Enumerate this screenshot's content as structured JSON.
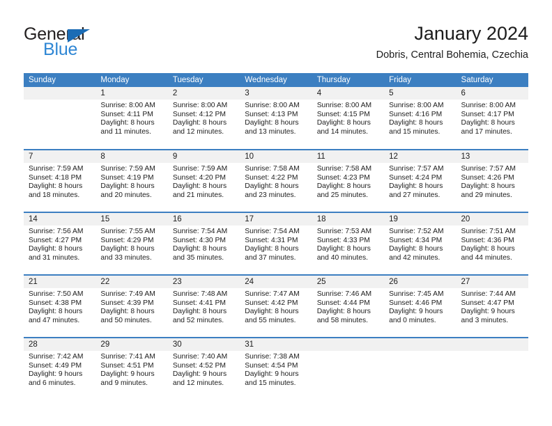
{
  "brand": {
    "name_part1": "General",
    "name_part2": "Blue",
    "triangle_color": "#1b6cb5",
    "blue_color": "#2e86d4"
  },
  "header": {
    "title": "January 2024",
    "subtitle": "Dobris, Central Bohemia, Czechia"
  },
  "theme": {
    "header_blue": "#3c7fc1",
    "band_gray": "#f1f1f1",
    "text": "#1c1c1c"
  },
  "weekdays": [
    "Sunday",
    "Monday",
    "Tuesday",
    "Wednesday",
    "Thursday",
    "Friday",
    "Saturday"
  ],
  "weeks": [
    [
      {
        "day": "",
        "sunrise": "",
        "sunset": "",
        "daylight_line1": "",
        "daylight_line2": ""
      },
      {
        "day": "1",
        "sunrise": "Sunrise: 8:00 AM",
        "sunset": "Sunset: 4:11 PM",
        "daylight_line1": "Daylight: 8 hours",
        "daylight_line2": "and 11 minutes."
      },
      {
        "day": "2",
        "sunrise": "Sunrise: 8:00 AM",
        "sunset": "Sunset: 4:12 PM",
        "daylight_line1": "Daylight: 8 hours",
        "daylight_line2": "and 12 minutes."
      },
      {
        "day": "3",
        "sunrise": "Sunrise: 8:00 AM",
        "sunset": "Sunset: 4:13 PM",
        "daylight_line1": "Daylight: 8 hours",
        "daylight_line2": "and 13 minutes."
      },
      {
        "day": "4",
        "sunrise": "Sunrise: 8:00 AM",
        "sunset": "Sunset: 4:15 PM",
        "daylight_line1": "Daylight: 8 hours",
        "daylight_line2": "and 14 minutes."
      },
      {
        "day": "5",
        "sunrise": "Sunrise: 8:00 AM",
        "sunset": "Sunset: 4:16 PM",
        "daylight_line1": "Daylight: 8 hours",
        "daylight_line2": "and 15 minutes."
      },
      {
        "day": "6",
        "sunrise": "Sunrise: 8:00 AM",
        "sunset": "Sunset: 4:17 PM",
        "daylight_line1": "Daylight: 8 hours",
        "daylight_line2": "and 17 minutes."
      }
    ],
    [
      {
        "day": "7",
        "sunrise": "Sunrise: 7:59 AM",
        "sunset": "Sunset: 4:18 PM",
        "daylight_line1": "Daylight: 8 hours",
        "daylight_line2": "and 18 minutes."
      },
      {
        "day": "8",
        "sunrise": "Sunrise: 7:59 AM",
        "sunset": "Sunset: 4:19 PM",
        "daylight_line1": "Daylight: 8 hours",
        "daylight_line2": "and 20 minutes."
      },
      {
        "day": "9",
        "sunrise": "Sunrise: 7:59 AM",
        "sunset": "Sunset: 4:20 PM",
        "daylight_line1": "Daylight: 8 hours",
        "daylight_line2": "and 21 minutes."
      },
      {
        "day": "10",
        "sunrise": "Sunrise: 7:58 AM",
        "sunset": "Sunset: 4:22 PM",
        "daylight_line1": "Daylight: 8 hours",
        "daylight_line2": "and 23 minutes."
      },
      {
        "day": "11",
        "sunrise": "Sunrise: 7:58 AM",
        "sunset": "Sunset: 4:23 PM",
        "daylight_line1": "Daylight: 8 hours",
        "daylight_line2": "and 25 minutes."
      },
      {
        "day": "12",
        "sunrise": "Sunrise: 7:57 AM",
        "sunset": "Sunset: 4:24 PM",
        "daylight_line1": "Daylight: 8 hours",
        "daylight_line2": "and 27 minutes."
      },
      {
        "day": "13",
        "sunrise": "Sunrise: 7:57 AM",
        "sunset": "Sunset: 4:26 PM",
        "daylight_line1": "Daylight: 8 hours",
        "daylight_line2": "and 29 minutes."
      }
    ],
    [
      {
        "day": "14",
        "sunrise": "Sunrise: 7:56 AM",
        "sunset": "Sunset: 4:27 PM",
        "daylight_line1": "Daylight: 8 hours",
        "daylight_line2": "and 31 minutes."
      },
      {
        "day": "15",
        "sunrise": "Sunrise: 7:55 AM",
        "sunset": "Sunset: 4:29 PM",
        "daylight_line1": "Daylight: 8 hours",
        "daylight_line2": "and 33 minutes."
      },
      {
        "day": "16",
        "sunrise": "Sunrise: 7:54 AM",
        "sunset": "Sunset: 4:30 PM",
        "daylight_line1": "Daylight: 8 hours",
        "daylight_line2": "and 35 minutes."
      },
      {
        "day": "17",
        "sunrise": "Sunrise: 7:54 AM",
        "sunset": "Sunset: 4:31 PM",
        "daylight_line1": "Daylight: 8 hours",
        "daylight_line2": "and 37 minutes."
      },
      {
        "day": "18",
        "sunrise": "Sunrise: 7:53 AM",
        "sunset": "Sunset: 4:33 PM",
        "daylight_line1": "Daylight: 8 hours",
        "daylight_line2": "and 40 minutes."
      },
      {
        "day": "19",
        "sunrise": "Sunrise: 7:52 AM",
        "sunset": "Sunset: 4:34 PM",
        "daylight_line1": "Daylight: 8 hours",
        "daylight_line2": "and 42 minutes."
      },
      {
        "day": "20",
        "sunrise": "Sunrise: 7:51 AM",
        "sunset": "Sunset: 4:36 PM",
        "daylight_line1": "Daylight: 8 hours",
        "daylight_line2": "and 44 minutes."
      }
    ],
    [
      {
        "day": "21",
        "sunrise": "Sunrise: 7:50 AM",
        "sunset": "Sunset: 4:38 PM",
        "daylight_line1": "Daylight: 8 hours",
        "daylight_line2": "and 47 minutes."
      },
      {
        "day": "22",
        "sunrise": "Sunrise: 7:49 AM",
        "sunset": "Sunset: 4:39 PM",
        "daylight_line1": "Daylight: 8 hours",
        "daylight_line2": "and 50 minutes."
      },
      {
        "day": "23",
        "sunrise": "Sunrise: 7:48 AM",
        "sunset": "Sunset: 4:41 PM",
        "daylight_line1": "Daylight: 8 hours",
        "daylight_line2": "and 52 minutes."
      },
      {
        "day": "24",
        "sunrise": "Sunrise: 7:47 AM",
        "sunset": "Sunset: 4:42 PM",
        "daylight_line1": "Daylight: 8 hours",
        "daylight_line2": "and 55 minutes."
      },
      {
        "day": "25",
        "sunrise": "Sunrise: 7:46 AM",
        "sunset": "Sunset: 4:44 PM",
        "daylight_line1": "Daylight: 8 hours",
        "daylight_line2": "and 58 minutes."
      },
      {
        "day": "26",
        "sunrise": "Sunrise: 7:45 AM",
        "sunset": "Sunset: 4:46 PM",
        "daylight_line1": "Daylight: 9 hours",
        "daylight_line2": "and 0 minutes."
      },
      {
        "day": "27",
        "sunrise": "Sunrise: 7:44 AM",
        "sunset": "Sunset: 4:47 PM",
        "daylight_line1": "Daylight: 9 hours",
        "daylight_line2": "and 3 minutes."
      }
    ],
    [
      {
        "day": "28",
        "sunrise": "Sunrise: 7:42 AM",
        "sunset": "Sunset: 4:49 PM",
        "daylight_line1": "Daylight: 9 hours",
        "daylight_line2": "and 6 minutes."
      },
      {
        "day": "29",
        "sunrise": "Sunrise: 7:41 AM",
        "sunset": "Sunset: 4:51 PM",
        "daylight_line1": "Daylight: 9 hours",
        "daylight_line2": "and 9 minutes."
      },
      {
        "day": "30",
        "sunrise": "Sunrise: 7:40 AM",
        "sunset": "Sunset: 4:52 PM",
        "daylight_line1": "Daylight: 9 hours",
        "daylight_line2": "and 12 minutes."
      },
      {
        "day": "31",
        "sunrise": "Sunrise: 7:38 AM",
        "sunset": "Sunset: 4:54 PM",
        "daylight_line1": "Daylight: 9 hours",
        "daylight_line2": "and 15 minutes."
      },
      {
        "day": "",
        "sunrise": "",
        "sunset": "",
        "daylight_line1": "",
        "daylight_line2": ""
      },
      {
        "day": "",
        "sunrise": "",
        "sunset": "",
        "daylight_line1": "",
        "daylight_line2": ""
      },
      {
        "day": "",
        "sunrise": "",
        "sunset": "",
        "daylight_line1": "",
        "daylight_line2": ""
      }
    ]
  ]
}
